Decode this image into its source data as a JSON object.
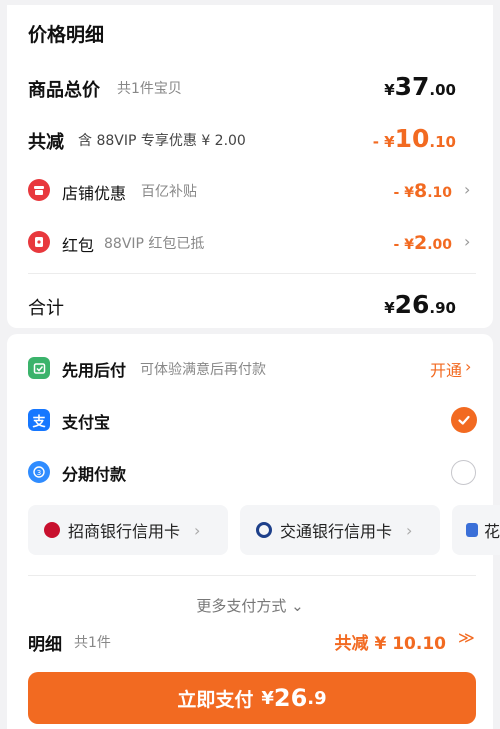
{
  "price_detail": {
    "title": "价格明细",
    "total": {
      "label": "商品总价",
      "sub": "共1件宝贝",
      "yen": "¥",
      "int": "37",
      "dec": ".00"
    },
    "discount": {
      "label": "共减",
      "sub": "含 88VIP 专享优惠 ¥ 2.00",
      "yen": "- ¥",
      "int": "10",
      "dec": ".10"
    },
    "shop": {
      "label": "店铺优惠",
      "sub": "百亿补贴",
      "yen": "- ¥",
      "int": "8",
      "dec": ".10",
      "chevron": "›"
    },
    "redpacket": {
      "label": "红包",
      "sub": "88VIP 红包已抵",
      "yen": "- ¥",
      "int": "2",
      "dec": ".00",
      "chevron": "›"
    },
    "sum": {
      "label": "合计",
      "yen": "¥",
      "int": "26",
      "dec": ".90"
    }
  },
  "payment": {
    "paylater": {
      "label": "先用后付",
      "sub": "可体验满意后再付款",
      "action": "开通",
      "chevron": "›"
    },
    "alipay": {
      "label": "支付宝",
      "icon_char": "支",
      "selected": true
    },
    "installment": {
      "label": "分期付款",
      "selected": false
    },
    "banks": [
      {
        "label": "招商银行信用卡",
        "chevron": "›"
      },
      {
        "label": "交通银行信用卡",
        "chevron": "›"
      },
      {
        "label": "花"
      }
    ],
    "more": {
      "label": "更多支付方式",
      "chevron": "⌄"
    }
  },
  "summary": {
    "label": "明细",
    "count": "共1件",
    "reduce": "共减 ¥ 10.10",
    "chevron": "≫"
  },
  "pay_button": {
    "label": "立即支付",
    "yen": "¥",
    "int": "26",
    "dec": ".9"
  },
  "colors": {
    "accent": "#f26a21",
    "alipay_blue": "#1677ff",
    "paylater_green": "#3bb36b",
    "shop_red": "#e8383d"
  }
}
